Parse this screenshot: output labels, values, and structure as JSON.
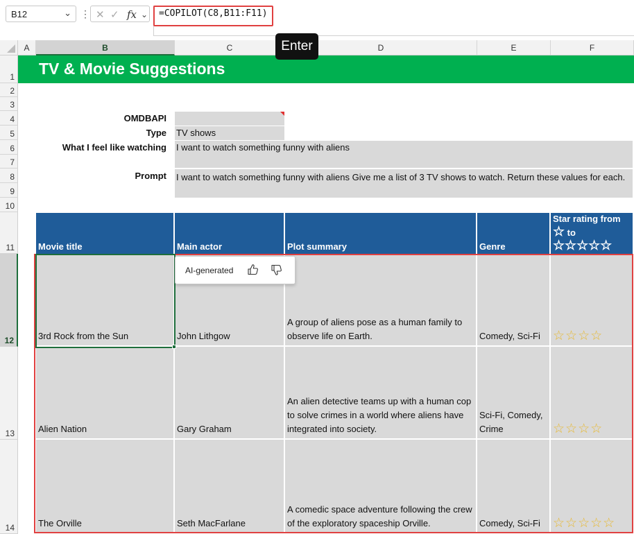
{
  "formula_bar": {
    "name_box": "B12",
    "fx_label": "fx",
    "formula": "=COPILOT(C8,B11:F11)"
  },
  "tooltip": {
    "label": "Enter"
  },
  "columns": [
    "A",
    "B",
    "C",
    "D",
    "E",
    "F"
  ],
  "rows": [
    "1",
    "2",
    "3",
    "4",
    "5",
    "6",
    "7",
    "8",
    "9",
    "10",
    "11",
    "12",
    "13",
    "14"
  ],
  "sheet": {
    "title": "TV & Movie Suggestions",
    "omdbapi_label": "OMDBAPI",
    "type_label": "Type",
    "type_value": "TV shows",
    "watching_label": "What I feel like watching",
    "watching_value": "I want to watch something funny with aliens",
    "prompt_label": "Prompt",
    "prompt_value": "I want to watch something funny with aliens Give me a list of 3 TV shows to watch. Return these values for each."
  },
  "table": {
    "headers": {
      "title": "Movie title",
      "actor": "Main actor",
      "plot": "Plot summary",
      "genre": "Genre",
      "rating_line1": "Star rating from",
      "rating_to": "to"
    },
    "rows": [
      {
        "title": "3rd Rock from the Sun",
        "actor": "John Lithgow",
        "plot": "A group of aliens pose as a human family to observe life on Earth.",
        "genre": "Comedy, Sci-Fi",
        "stars": 4
      },
      {
        "title": "Alien Nation",
        "actor": "Gary Graham",
        "plot": "An alien detective teams up with a human cop to solve crimes in a world where aliens have integrated into society.",
        "genre": "Sci-Fi, Comedy, Crime",
        "stars": 4
      },
      {
        "title": "The Orville",
        "actor": "Seth MacFarlane",
        "plot": "A comedic space adventure following the crew of the exploratory spaceship Orville.",
        "genre": "Comedy, Sci-Fi",
        "stars": 5
      }
    ]
  },
  "ai_popup": {
    "label": "AI-generated"
  },
  "colors": {
    "banner": "#00b050",
    "table_header": "#1f5c99",
    "star": "#e8b931",
    "outline": "#e04040",
    "selection": "#1e6e3c"
  }
}
